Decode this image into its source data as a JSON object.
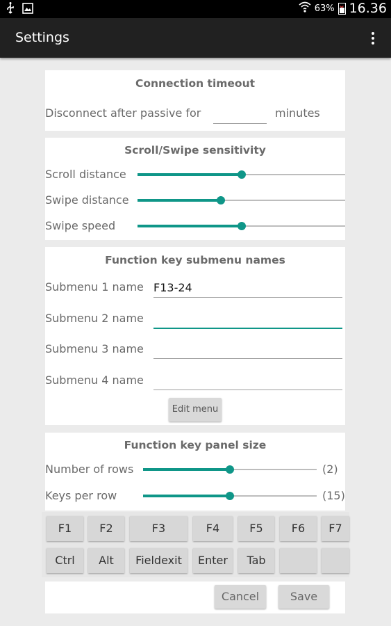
{
  "status_bar": {
    "battery": "63%",
    "time": "16.36"
  },
  "app_bar": {
    "title": "Settings"
  },
  "connection": {
    "title": "Connection timeout",
    "label_before": "Disconnect after passive for",
    "minutes_value": "",
    "label_after": "minutes"
  },
  "scroll": {
    "title": "Scroll/Swipe sensitivity",
    "items": [
      {
        "label": "Scroll distance",
        "level": 0.5
      },
      {
        "label": "Swipe distance",
        "level": 0.4
      },
      {
        "label": "Swipe speed",
        "level": 0.5
      }
    ]
  },
  "submenus": {
    "title": "Function key submenu names",
    "items": [
      {
        "label": "Submenu 1 name",
        "value": "F13-24"
      },
      {
        "label": "Submenu 2 name",
        "value": ""
      },
      {
        "label": "Submenu 3 name",
        "value": ""
      },
      {
        "label": "Submenu 4 name",
        "value": ""
      }
    ],
    "edit_button": "Edit menu"
  },
  "panel": {
    "title": "Function key panel size",
    "rows": {
      "label": "Number of rows",
      "value": "(2)",
      "level": 0.5
    },
    "keys": {
      "label": "Keys per row",
      "value": "(15)",
      "level": 0.5
    }
  },
  "function_keys": {
    "row1": [
      "F1",
      "F2",
      "F3",
      "F4",
      "F5",
      "F6",
      "F7"
    ],
    "row2": [
      "Ctrl",
      "Alt",
      "Fieldexit",
      "Enter",
      "Tab",
      "",
      ""
    ]
  },
  "actions": {
    "cancel": "Cancel",
    "save": "Save"
  },
  "colors": {
    "accent": "#0f9688",
    "app_bar": "#212121",
    "status_bar": "#000000",
    "background": "#ebebeb"
  },
  "icons": [
    "usb-icon",
    "image-icon",
    "wifi-icon",
    "battery-icon",
    "overflow-menu-icon"
  ]
}
